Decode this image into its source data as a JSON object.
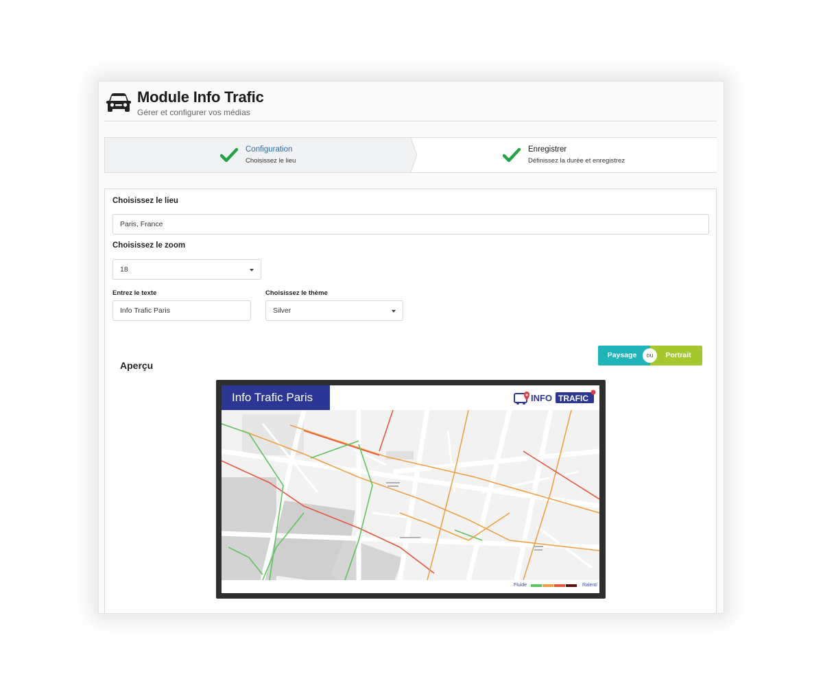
{
  "header": {
    "title": "Module Info Trafic",
    "subtitle": "Gérer et configurer vos médias",
    "icon": "car-icon"
  },
  "stepper": {
    "steps": [
      {
        "title": "Configuration",
        "description": "Choisissez le lieu",
        "status": "done",
        "active": true
      },
      {
        "title": "Enregistrer",
        "description": "Définissez la durée et enregistrez",
        "status": "done",
        "active": false
      }
    ]
  },
  "form": {
    "lieu": {
      "label": "Choisissez le lieu",
      "value": "Paris, France"
    },
    "zoom": {
      "label": "Choisissez le zoom",
      "value": "18"
    },
    "texte": {
      "label": "Entrez le texte",
      "value": "Info Trafic Paris"
    },
    "theme": {
      "label": "Choisissez le thème",
      "value": "Silver"
    }
  },
  "orientation": {
    "paysage_label": "Paysage",
    "separator": "ou",
    "portrait_label": "Portrait"
  },
  "preview": {
    "heading": "Aperçu",
    "screen_title": "Info Trafic Paris",
    "logo_text_left": "INFO",
    "logo_text_right": "TRAFIC",
    "legend_start": "Fluide",
    "legend_end": "Ralenti",
    "legend_colors": [
      "#5cc45c",
      "#f0a040",
      "#e8553a",
      "#b32020",
      "#5a0f0f"
    ]
  },
  "colors": {
    "accent_blue": "#2b6cb0",
    "check_green": "#21a346",
    "paysage": "#1fb4b8",
    "portrait": "#a6c82f",
    "screen_title_bg": "#2c3694"
  }
}
